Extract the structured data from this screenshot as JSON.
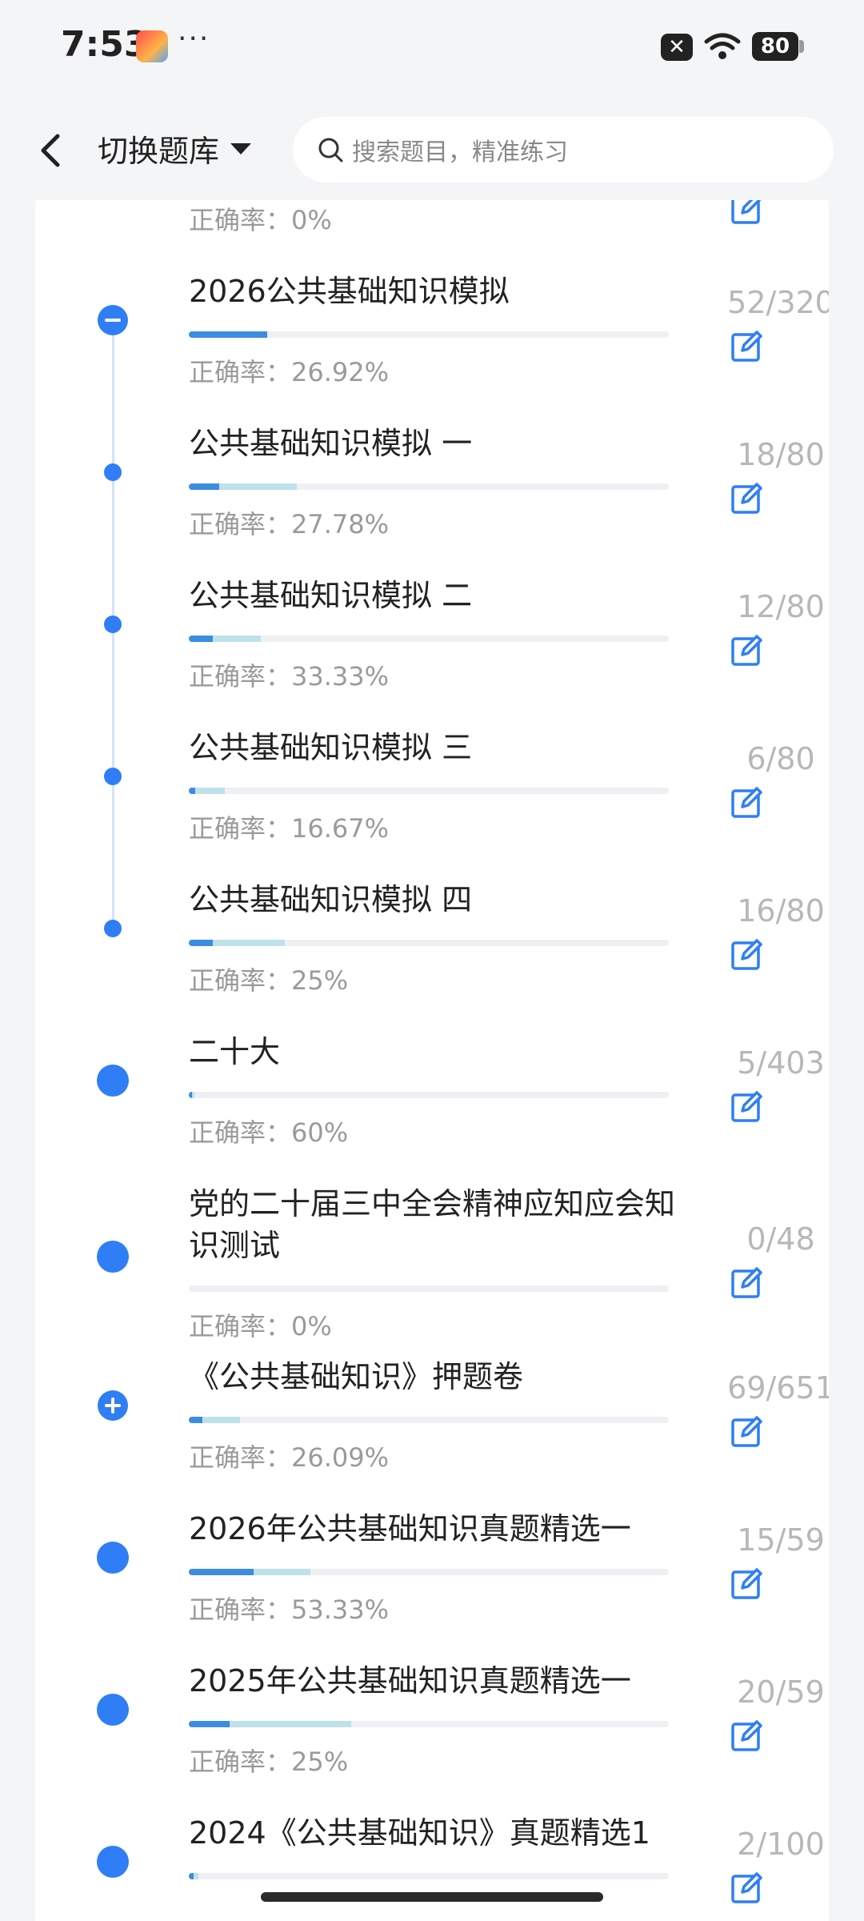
{
  "status_bar": {
    "time": "7:53",
    "dots": "···",
    "battery": "80"
  },
  "header": {
    "switch_label": "切换题库",
    "search_placeholder": "搜索题目，精准练习"
  },
  "partial_top": {
    "accuracy": "正确率：0%"
  },
  "items": [
    {
      "title": "2026公共基础知识模拟",
      "accuracy": "正确率：26.92%",
      "count": "52/320",
      "node": "collapse",
      "progress_done": 0.0417,
      "progress_correct": 0.1625
    },
    {
      "title": "公共基础知识模拟 一",
      "accuracy": "正确率：27.78%",
      "count": "18/80",
      "node": "sub",
      "progress_done": 0.225,
      "progress_correct": 0.0625
    },
    {
      "title": "公共基础知识模拟 二",
      "accuracy": "正确率：33.33%",
      "count": "12/80",
      "node": "sub",
      "progress_done": 0.15,
      "progress_correct": 0.05
    },
    {
      "title": "公共基础知识模拟 三",
      "accuracy": "正确率：16.67%",
      "count": "6/80",
      "node": "sub",
      "progress_done": 0.075,
      "progress_correct": 0.0125
    },
    {
      "title": "公共基础知识模拟 四",
      "accuracy": "正确率：25%",
      "count": "16/80",
      "node": "sub",
      "progress_done": 0.2,
      "progress_correct": 0.05
    },
    {
      "title": "二十大",
      "accuracy": "正确率：60%",
      "count": "5/403",
      "node": "dot",
      "progress_done": 0.0124,
      "progress_correct": 0.0074
    },
    {
      "title": "党的二十届三中全会精神应知应会知识测试",
      "accuracy": "正确率：0%",
      "count": "0/48",
      "node": "dot",
      "progress_done": 0.0,
      "progress_correct": 0.0
    },
    {
      "title": "《公共基础知识》押题卷",
      "accuracy": "正确率：26.09%",
      "count": "69/651",
      "node": "expand",
      "progress_done": 0.106,
      "progress_correct": 0.0276
    },
    {
      "title": "2026年公共基础知识真题精选一",
      "accuracy": "正确率：53.33%",
      "count": "15/59",
      "node": "dot",
      "progress_done": 0.254,
      "progress_correct": 0.1356
    },
    {
      "title": "2025年公共基础知识真题精选一",
      "accuracy": "正确率：25%",
      "count": "20/59",
      "node": "dot",
      "progress_done": 0.339,
      "progress_correct": 0.0847
    },
    {
      "title": "2024《公共基础知识》真题精选1",
      "accuracy": "",
      "count": "2/100",
      "node": "dot",
      "progress_done": 0.02,
      "progress_correct": 0.01
    }
  ],
  "colors": {
    "accent": "#2f7ef5",
    "progress_correct": "#3c8de0",
    "progress_done": "#bfe1ea",
    "muted": "#9a9a9a"
  }
}
